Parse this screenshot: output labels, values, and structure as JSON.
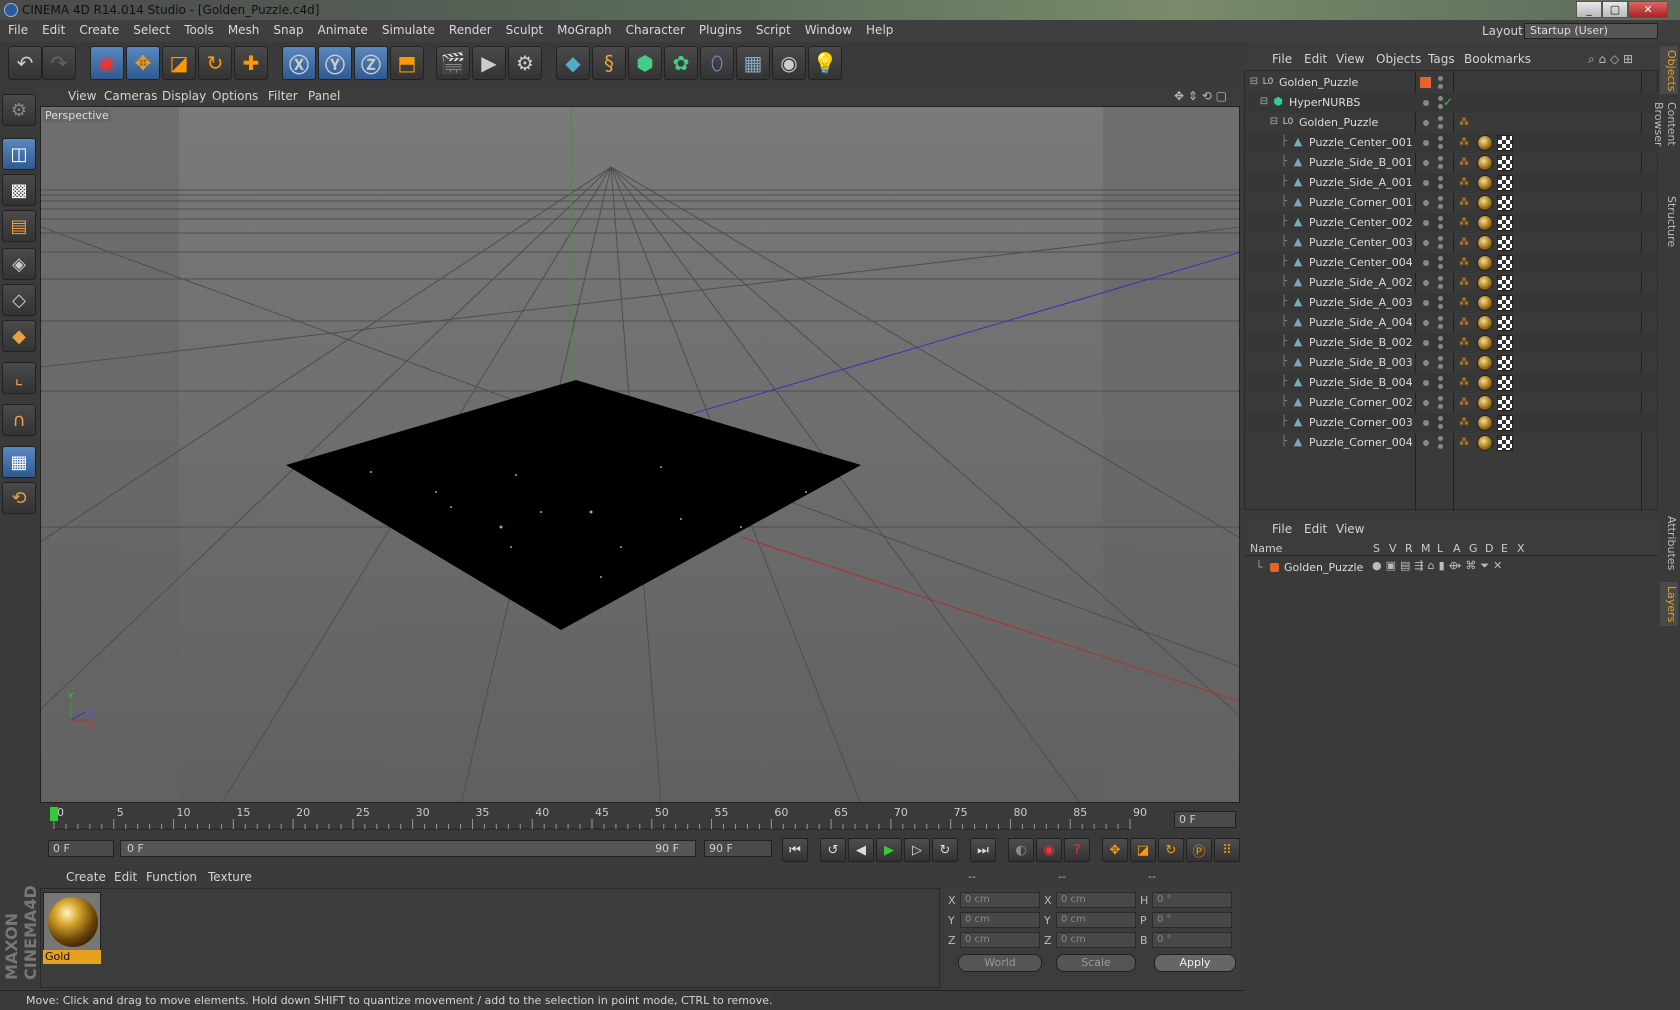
{
  "window": {
    "title": "CINEMA 4D R14.014 Studio - [Golden_Puzzle.c4d]",
    "buttons": [
      "_",
      "▢",
      "✕"
    ]
  },
  "menu": [
    "File",
    "Edit",
    "Create",
    "Select",
    "Tools",
    "Mesh",
    "Snap",
    "Animate",
    "Simulate",
    "Render",
    "Sculpt",
    "MoGraph",
    "Character",
    "Plugins",
    "Script",
    "Window",
    "Help"
  ],
  "layout": {
    "label": "Layout:",
    "value": "Startup (User)"
  },
  "viewport": {
    "menu": [
      "View",
      "Cameras",
      "Display",
      "Options",
      "Filter",
      "Panel"
    ],
    "label": "Perspective"
  },
  "timeline": {
    "ticks": [
      "0",
      "5",
      "10",
      "15",
      "20",
      "25",
      "30",
      "35",
      "40",
      "45",
      "50",
      "55",
      "60",
      "65",
      "70",
      "75",
      "80",
      "85",
      "90"
    ],
    "current_frame": "0 F",
    "start": "0 F",
    "range_start": "0 F",
    "range_end": "90 F",
    "end": "90 F"
  },
  "materials": {
    "menu": [
      "Create",
      "Edit",
      "Function",
      "Texture"
    ],
    "items": [
      {
        "name": "Gold"
      }
    ]
  },
  "coordinates": {
    "headers": [
      "--",
      "--",
      "--"
    ],
    "rows": [
      {
        "a": "X",
        "pos": "0 cm",
        "b": "X",
        "size": "0 cm",
        "c": "H",
        "rot": "0 °"
      },
      {
        "a": "Y",
        "pos": "0 cm",
        "b": "Y",
        "size": "0 cm",
        "c": "P",
        "rot": "0 °"
      },
      {
        "a": "Z",
        "pos": "0 cm",
        "b": "Z",
        "size": "0 cm",
        "c": "B",
        "rot": "0 °"
      }
    ],
    "mode": "World",
    "transform": "Scale",
    "apply": "Apply"
  },
  "status": "Move: Click and drag to move elements. Hold down SHIFT to quantize movement / add to the selection in point mode, CTRL to remove.",
  "objects": {
    "menu": [
      "File",
      "Edit",
      "View",
      "Objects",
      "Tags",
      "Bookmarks"
    ],
    "tree": [
      {
        "name": "Golden_Puzzle",
        "level": 0,
        "icon": "null-icon"
      },
      {
        "name": "HyperNURBS",
        "level": 1,
        "icon": "hypernurbs-icon"
      },
      {
        "name": "Golden_Puzzle",
        "level": 2,
        "icon": "null-icon"
      },
      {
        "name": "Puzzle_Center_001",
        "level": 3,
        "icon": "polygon-icon"
      },
      {
        "name": "Puzzle_Side_B_001",
        "level": 3,
        "icon": "polygon-icon"
      },
      {
        "name": "Puzzle_Side_A_001",
        "level": 3,
        "icon": "polygon-icon"
      },
      {
        "name": "Puzzle_Corner_001",
        "level": 3,
        "icon": "polygon-icon"
      },
      {
        "name": "Puzzle_Center_002",
        "level": 3,
        "icon": "polygon-icon"
      },
      {
        "name": "Puzzle_Center_003",
        "level": 3,
        "icon": "polygon-icon"
      },
      {
        "name": "Puzzle_Center_004",
        "level": 3,
        "icon": "polygon-icon"
      },
      {
        "name": "Puzzle_Side_A_002",
        "level": 3,
        "icon": "polygon-icon"
      },
      {
        "name": "Puzzle_Side_A_003",
        "level": 3,
        "icon": "polygon-icon"
      },
      {
        "name": "Puzzle_Side_A_004",
        "level": 3,
        "icon": "polygon-icon"
      },
      {
        "name": "Puzzle_Side_B_002",
        "level": 3,
        "icon": "polygon-icon"
      },
      {
        "name": "Puzzle_Side_B_003",
        "level": 3,
        "icon": "polygon-icon"
      },
      {
        "name": "Puzzle_Side_B_004",
        "level": 3,
        "icon": "polygon-icon"
      },
      {
        "name": "Puzzle_Corner_002",
        "level": 3,
        "icon": "polygon-icon"
      },
      {
        "name": "Puzzle_Corner_003",
        "level": 3,
        "icon": "polygon-icon"
      },
      {
        "name": "Puzzle_Corner_004",
        "level": 3,
        "icon": "polygon-icon"
      }
    ]
  },
  "layers": {
    "menu": [
      "File",
      "Edit",
      "View"
    ],
    "columns": [
      "Name",
      "S",
      "V",
      "R",
      "M",
      "L",
      "A",
      "G",
      "D",
      "E",
      "X"
    ],
    "items": [
      {
        "name": "Golden_Puzzle",
        "color": "#e8622a"
      }
    ]
  },
  "side_tabs": [
    "Objects",
    "Content Browser",
    "Structure",
    "Attributes",
    "Layers"
  ],
  "colors": {
    "accent": "#e8a020",
    "selected": "#2f5a90",
    "axis_x": "#b03030",
    "axis_y": "#30a030",
    "axis_z": "#3030b0"
  }
}
